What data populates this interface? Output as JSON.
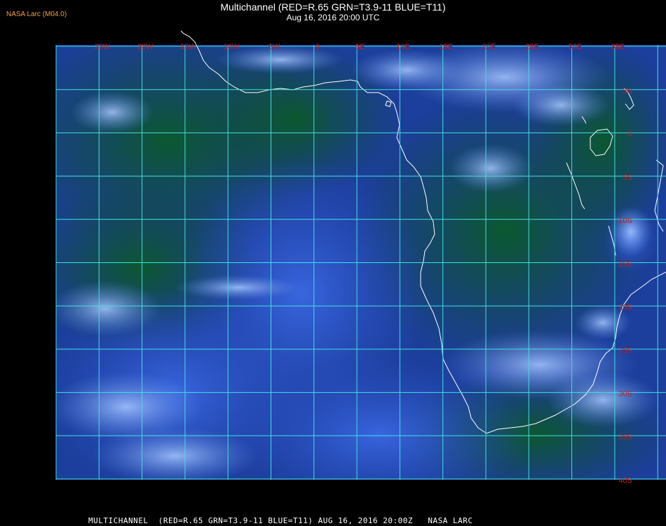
{
  "header": {
    "brand": "NASA Larc (M04.0)",
    "title": "Multichannel (RED=R.65 GRN=T3.9-11 BLUE=T11)",
    "subtitle": "Aug 16, 2016 20:00 UTC"
  },
  "footer": {
    "caption": "MULTICHANNEL  (RED=R.65 GRN=T3.9-11 BLUE=T11) AUG 16, 2016 20:00Z   NASA LARC"
  },
  "map": {
    "colors": {
      "grid": "#40e0e0",
      "coast": "#ffffff",
      "label": "#cc1a1a",
      "ocean": "#2a4ec0",
      "land": "#0d4a24",
      "cloud": "#86b4f0"
    },
    "lon_labels": [
      "25W",
      "20W",
      "15W",
      "10W",
      "5W",
      "0",
      "5E",
      "10E",
      "15E",
      "20E",
      "25E",
      "30E",
      "35E"
    ],
    "lat_labels": [
      "5N",
      "0",
      "5S",
      "10S",
      "15S",
      "20S",
      "25S",
      "30S",
      "35S",
      "40S"
    ]
  }
}
